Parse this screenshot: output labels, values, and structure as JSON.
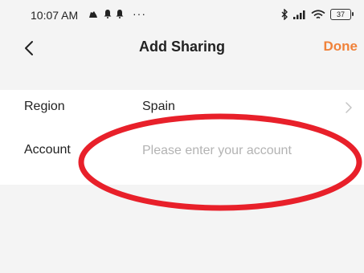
{
  "status_bar": {
    "time": "10:07 AM",
    "dots": "···",
    "battery": "37",
    "icons": [
      "cloud-icon",
      "bell-icon",
      "bell-icon",
      "bluetooth-icon",
      "signal-icon",
      "wifi-icon",
      "battery-icon"
    ]
  },
  "nav": {
    "back_icon": "chevron-left-icon",
    "title": "Add Sharing",
    "done_label": "Done"
  },
  "form": {
    "region_label": "Region",
    "region_value": "Spain",
    "account_label": "Account",
    "account_placeholder": "Please enter your account",
    "account_value": ""
  },
  "colors": {
    "accent": "#f0823a",
    "background": "#f4f4f4",
    "card": "#ffffff",
    "annotation": "#e8202a"
  }
}
